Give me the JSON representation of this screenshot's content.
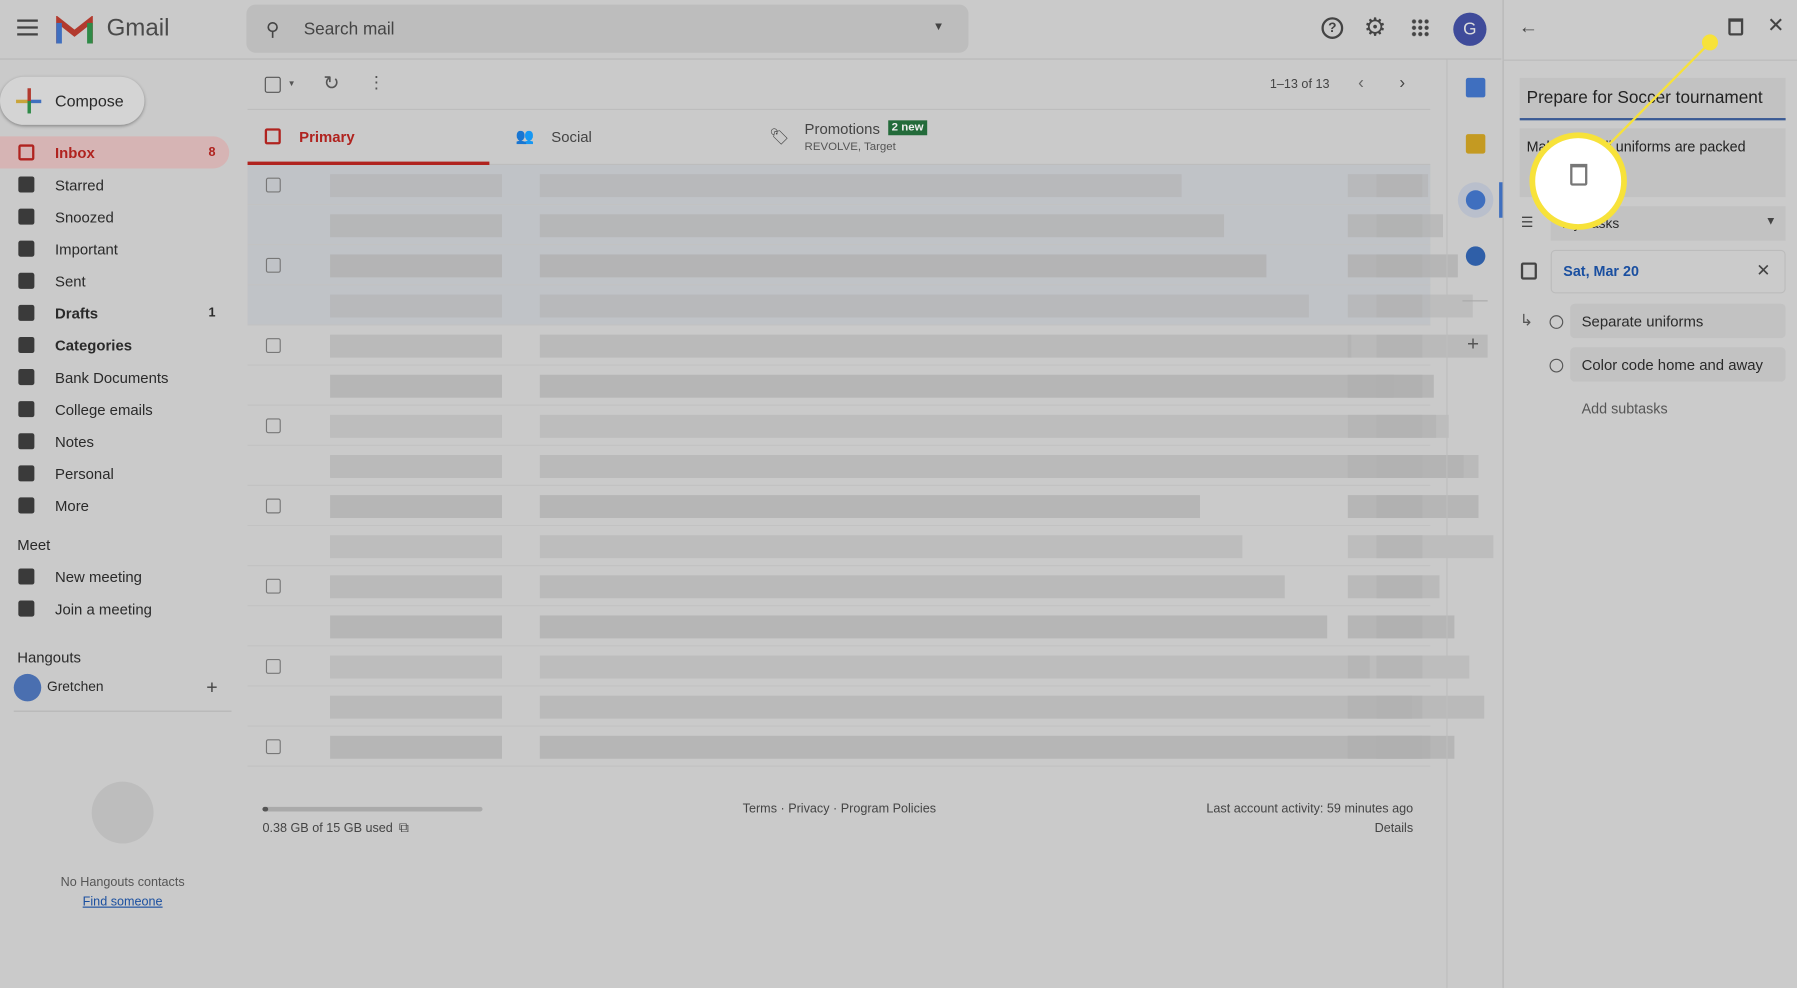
{
  "header": {
    "app_name": "Gmail",
    "search_placeholder": "Search mail",
    "avatar_letter": "G"
  },
  "sidebar": {
    "compose": "Compose",
    "items": [
      {
        "label": "Inbox",
        "count": "8",
        "icon": "inbox-icon"
      },
      {
        "label": "Starred",
        "icon": "star-icon"
      },
      {
        "label": "Snoozed",
        "icon": "clock-icon"
      },
      {
        "label": "Important",
        "icon": "important-icon"
      },
      {
        "label": "Sent",
        "icon": "send-icon"
      },
      {
        "label": "Drafts",
        "count": "1",
        "icon": "draft-icon"
      },
      {
        "label": "Categories",
        "icon": "label-icon"
      },
      {
        "label": "Bank Documents",
        "icon": "label-icon"
      },
      {
        "label": "College emails",
        "icon": "label-icon"
      },
      {
        "label": "Notes",
        "icon": "label-icon"
      },
      {
        "label": "Personal",
        "icon": "label-icon"
      },
      {
        "label": "More",
        "icon": "chevron-down-icon"
      }
    ],
    "meet": {
      "title": "Meet",
      "new_meeting": "New meeting",
      "join": "Join a meeting"
    },
    "hangouts": {
      "title": "Hangouts",
      "user": "Gretchen",
      "empty": "No Hangouts contacts",
      "find": "Find someone"
    }
  },
  "toolbar": {
    "pagination": "1–13 of 13"
  },
  "tabs": [
    {
      "label": "Primary"
    },
    {
      "label": "Social"
    },
    {
      "label": "Promotions",
      "badge": "2 new",
      "sub": "REVOLVE, Target"
    }
  ],
  "footer": {
    "storage": "0.38 GB of 15 GB used",
    "storage_fraction": 0.025,
    "links": "Terms · Privacy · Program Policies",
    "activity": "Last account activity: 59 minutes ago",
    "details": "Details"
  },
  "tasks": {
    "title": "Prepare for Soccer tournament",
    "details": "Make sure all uniforms are packed",
    "list": "My Tasks",
    "date": "Sat, Mar 20",
    "subtasks": [
      "Separate uniforms",
      "Color code home and away"
    ],
    "add_subtasks": "Add subtasks"
  },
  "colors": {
    "highlight": "#f7e23a",
    "accent": "#c5221f",
    "link": "#1a4fa0"
  }
}
